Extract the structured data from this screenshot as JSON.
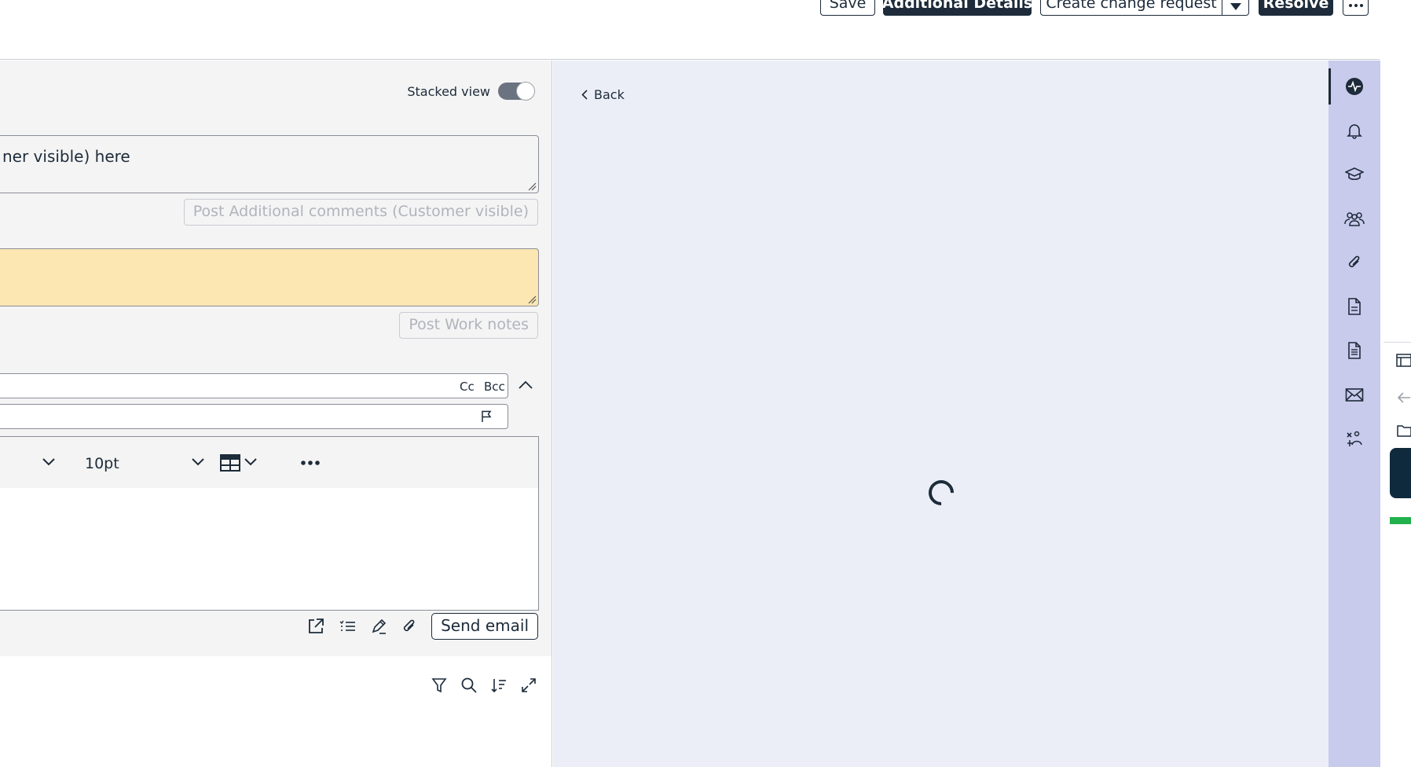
{
  "header": {
    "save_label": "Save",
    "additional_details_label": "Additional Details",
    "create_change_request_label": "Create change request",
    "resolve_label": "Resolve",
    "more_label": "•••"
  },
  "left_panel": {
    "stacked_view_label": "Stacked view",
    "stacked_view_on": true,
    "comments_text": "ner visible) here",
    "post_comments_label": "Post Additional comments (Customer visible)",
    "work_notes_text": "",
    "post_work_notes_label": "Post Work notes",
    "cc_label": "Cc",
    "bcc_label": "Bcc",
    "font_size_value": "10pt",
    "send_email_label": "Send email"
  },
  "right_panel": {
    "back_label": "Back",
    "loading": true
  },
  "rail": {
    "items": [
      "activity-icon",
      "bell-icon",
      "graduation-cap-icon",
      "group-icon",
      "paperclip-icon",
      "document-icon",
      "document-lines-icon",
      "envelope-icon",
      "assign-icon"
    ]
  },
  "colors": {
    "primary": "#1d2b3a",
    "panel_bg": "#eceef7",
    "rail_bg": "#c9cbec",
    "work_notes_bg": "#fce6b1",
    "left_bg": "#f4f4f4"
  }
}
